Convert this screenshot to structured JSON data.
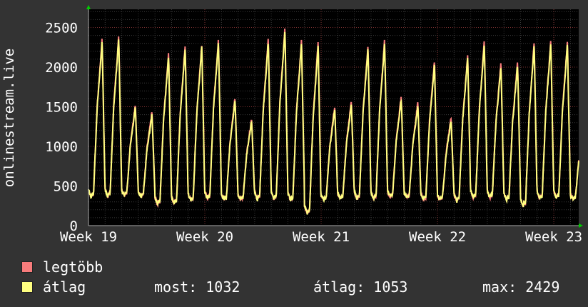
{
  "colors": {
    "background": "#333333",
    "plot_background": "#000000",
    "max_series": "#f87c7c",
    "avg_series": "#ffff80",
    "grid_major": "#7a3030",
    "grid_minor": "#3a3a3a",
    "axis_arrow": "#00cc00"
  },
  "legend": {
    "max_label": "legtöbb",
    "avg_label": "átlag"
  },
  "stats": {
    "now": "most: 1032",
    "avg": "átlag: 1053",
    "max": "max: 2429"
  },
  "chart_data": {
    "type": "line",
    "ylabel": "onlinestream.live",
    "ylim": [
      0,
      2500
    ],
    "yticks": [
      "0",
      "500",
      "1000",
      "1500",
      "2000",
      "2500"
    ],
    "xtick_labels": [
      "Week 19",
      "Week 20",
      "Week 21",
      "Week 22",
      "Week 23"
    ],
    "x_unit": "day",
    "x_range_days": [
      0,
      29.5
    ],
    "grid": true,
    "legend_placement": "bottom-left",
    "daily_peaks": [
      2330,
      2360,
      1500,
      1400,
      2150,
      2250,
      2270,
      2330,
      1580,
      1320,
      2330,
      2460,
      2310,
      2290,
      1480,
      1540,
      2240,
      2310,
      1600,
      1520,
      2040,
      1330,
      2120,
      2300,
      2020,
      2040,
      2280,
      2300,
      2290,
      1240
    ],
    "daily_troughs": [
      350,
      360,
      380,
      370,
      260,
      270,
      300,
      330,
      330,
      330,
      320,
      330,
      310,
      140,
      320,
      340,
      330,
      320,
      360,
      350,
      320,
      330,
      300,
      340,
      350,
      320,
      240,
      330,
      340,
      330
    ],
    "series": [
      {
        "name": "legtöbb",
        "color": "#f87c7c",
        "values_ref": "daily_peaks+offset",
        "offset": 40
      },
      {
        "name": "átlag",
        "color": "#ffff80",
        "values_ref": "daily_peaks"
      }
    ],
    "summary": {
      "now": 1032,
      "avg": 1053,
      "max": 2429
    }
  }
}
